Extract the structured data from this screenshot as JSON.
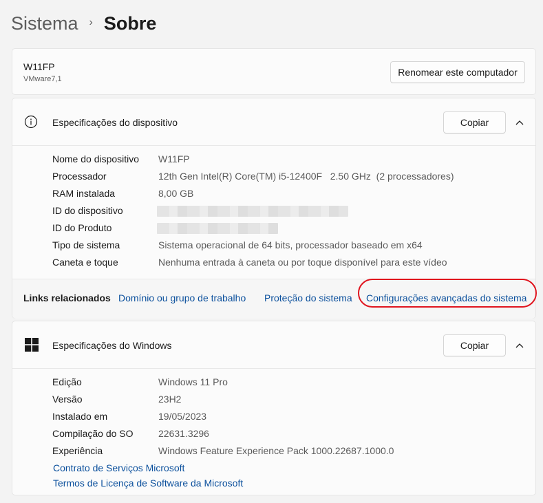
{
  "breadcrumb": {
    "parent": "Sistema",
    "separator": "›",
    "current": "Sobre"
  },
  "computer": {
    "name": "W11FP",
    "model": "VMware7,1",
    "rename_label": "Renomear este computador"
  },
  "device_specs": {
    "title": "Especificações do dispositivo",
    "copy_label": "Copiar",
    "rows": [
      {
        "label": "Nome do dispositivo",
        "value": "W11FP"
      },
      {
        "label": "Processador",
        "value": "12th Gen Intel(R) Core(TM) i5-12400F   2.50 GHz  (2 processadores)"
      },
      {
        "label": "RAM instalada",
        "value": "8,00 GB"
      },
      {
        "label": "ID do dispositivo",
        "value": ""
      },
      {
        "label": "ID do Produto",
        "value": ""
      },
      {
        "label": "Tipo de sistema",
        "value": "Sistema operacional de 64 bits, processador baseado em x64"
      },
      {
        "label": "Caneta e toque",
        "value": "Nenhuma entrada à caneta ou por toque disponível para este vídeo"
      }
    ]
  },
  "related_links": {
    "label": "Links relacionados",
    "links": [
      "Domínio ou grupo de trabalho",
      "Proteção do sistema",
      "Configurações avançadas do sistema"
    ]
  },
  "windows_specs": {
    "title": "Especificações do Windows",
    "copy_label": "Copiar",
    "rows": [
      {
        "label": "Edição",
        "value": "Windows 11 Pro"
      },
      {
        "label": "Versão",
        "value": "23H2"
      },
      {
        "label": "Instalado em",
        "value": "19/05/2023"
      },
      {
        "label": "Compilação do SO",
        "value": "22631.3296"
      },
      {
        "label": "Experiência",
        "value": "Windows Feature Experience Pack 1000.22687.1000.0"
      }
    ],
    "links": [
      "Contrato de Serviços Microsoft",
      "Termos de Licença de Software da Microsoft"
    ]
  },
  "colors": {
    "link": "#0a4f9c",
    "highlight": "#e0141e",
    "background": "#f3f3f3"
  }
}
